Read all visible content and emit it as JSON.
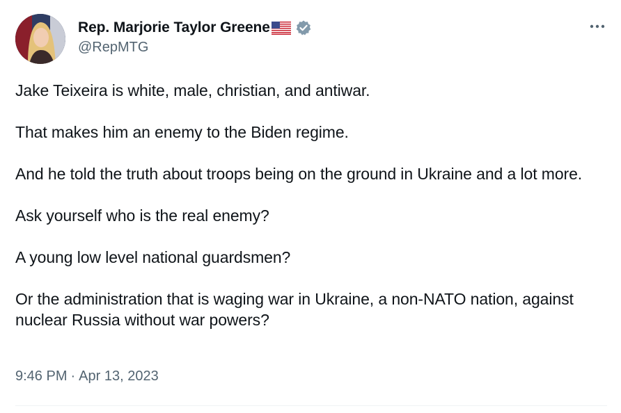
{
  "author": {
    "display_name": "Rep. Marjorie Taylor Greene",
    "handle": "@RepMTG",
    "flag_icon": "us-flag-icon",
    "verified_icon": "verified-badge-icon",
    "verified_color": "#829aab"
  },
  "more_icon": "more-options-icon",
  "tweet": {
    "paragraphs": [
      "Jake Teixeira is white, male, christian, and antiwar.",
      "That makes him an enemy to the Biden regime.",
      "And he told the truth about troops being on the ground in Ukraine and a lot more.",
      "Ask yourself who is the real enemy?",
      "A young low level national guardsmen?",
      "Or the administration that is waging war in Ukraine, a non-NATO nation, against nuclear Russia without war powers?"
    ]
  },
  "meta": {
    "time": "9:46 PM",
    "separator": "·",
    "date": "Apr 13, 2023"
  }
}
